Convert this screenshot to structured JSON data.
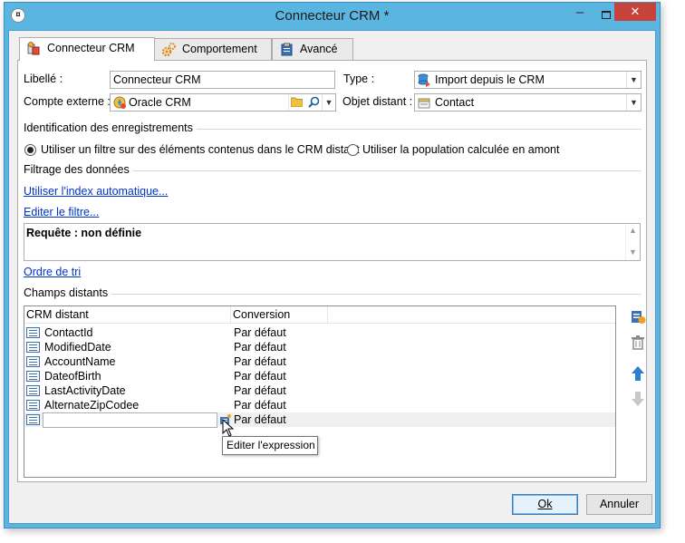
{
  "window": {
    "title": "Connecteur CRM *",
    "minimize": "–",
    "close": "✕"
  },
  "tabs": [
    {
      "label": "Connecteur CRM",
      "icon": "crm-connector-icon",
      "selected": true
    },
    {
      "label": "Comportement",
      "icon": "gears-icon",
      "selected": false
    },
    {
      "label": "Avancé",
      "icon": "clipboard-icon",
      "selected": false
    }
  ],
  "form": {
    "libelle_label": "Libellé :",
    "libelle_value": "Connecteur CRM",
    "type_label": "Type :",
    "type_value": "Import depuis le CRM",
    "compte_label": "Compte externe :",
    "compte_value": "Oracle CRM",
    "objet_label": "Objet distant :",
    "objet_value": "Contact"
  },
  "identification": {
    "title": "Identification des enregistrements",
    "option1": "Utiliser un filtre sur des éléments contenus dans le CRM distant",
    "option2": "Utiliser la population calculée en amont",
    "selected": "option1"
  },
  "filtrage": {
    "title": "Filtrage des données",
    "index_link": "Utiliser l'index automatique...",
    "edit_filter_link": "Editer le filtre...",
    "query_text": "Requête : non définie",
    "sort_link": "Ordre de tri"
  },
  "champs": {
    "title": "Champs distants",
    "columns": [
      "CRM distant",
      "Conversion"
    ],
    "rows": [
      {
        "name": "ContactId",
        "conversion": "Par défaut"
      },
      {
        "name": "ModifiedDate",
        "conversion": "Par défaut"
      },
      {
        "name": "AccountName",
        "conversion": "Par défaut"
      },
      {
        "name": "DateofBirth",
        "conversion": "Par défaut"
      },
      {
        "name": "LastActivityDate",
        "conversion": "Par défaut"
      },
      {
        "name": "AlternateZipCodee",
        "conversion": "Par défaut"
      }
    ],
    "edit_row_conversion": "Par défaut",
    "tooltip": "Editer l'expression"
  },
  "buttons": {
    "ok": "Ok",
    "cancel": "Annuler"
  },
  "colors": {
    "title_bar": "#5ab6e0",
    "close_button": "#c7423a",
    "link": "#0033cc"
  }
}
